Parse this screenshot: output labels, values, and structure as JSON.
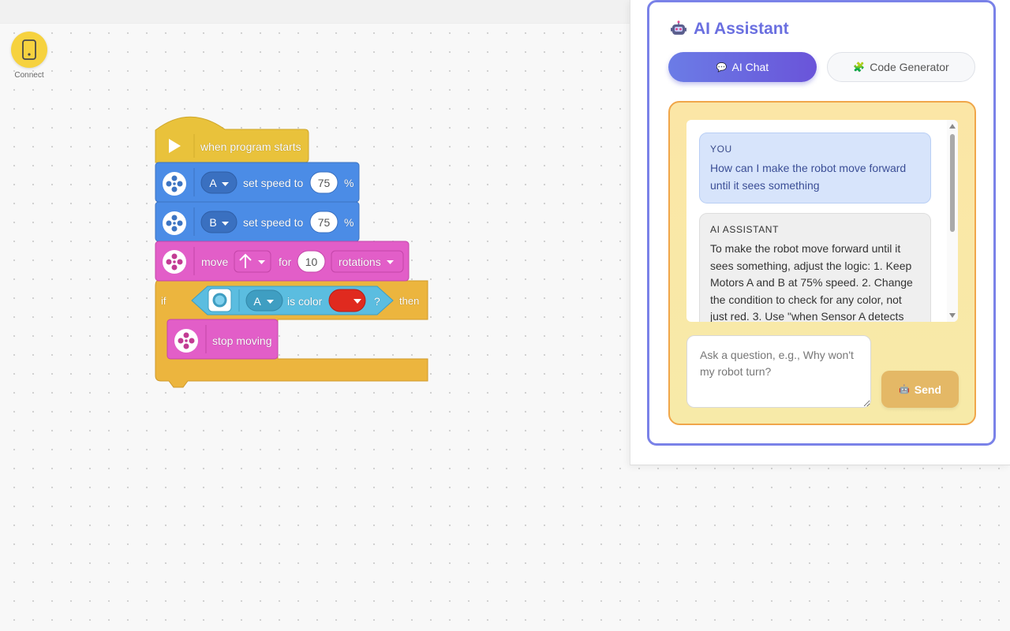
{
  "connect": {
    "label": "Connect",
    "icon": "phone-icon"
  },
  "program": {
    "trigger_label": "when program starts",
    "speed_blocks": [
      {
        "motor": "A",
        "label": "set speed to",
        "value": "75",
        "unit": "%"
      },
      {
        "motor": "B",
        "label": "set speed to",
        "value": "75",
        "unit": "%"
      }
    ],
    "move_block": {
      "label": "move",
      "direction": "↑",
      "for_label": "for",
      "amount": "10",
      "unit": "rotations"
    },
    "if_block": {
      "if_label": "if",
      "sensor": "A",
      "condition": "is color",
      "color": "#e02a1f",
      "question": "?",
      "then_label": "then"
    },
    "stop_block": {
      "label": "stop moving"
    }
  },
  "assistant": {
    "title": "AI Assistant",
    "tabs": [
      {
        "label": "AI Chat",
        "icon": "💬",
        "active": true
      },
      {
        "label": "Code Generator",
        "icon": "🧩",
        "active": false
      }
    ],
    "messages": [
      {
        "sender": "YOU",
        "text": "How can I make the robot move forward until it sees something"
      },
      {
        "sender": "AI ASSISTANT",
        "text": "To make the robot move forward until it sees something, adjust the logic: 1. Keep Motors A and B at 75% speed. 2. Change the condition to check for any color, not just red. 3. Use \"when Sensor A detects"
      }
    ],
    "input_placeholder": "Ask a question, e.g., Why won't my robot turn?",
    "send_label": "Send",
    "send_icon": "🤖",
    "colors": {
      "accent": "#6b6fe0",
      "chat_border": "#f0a64a",
      "send_button": "#e4b866"
    }
  }
}
